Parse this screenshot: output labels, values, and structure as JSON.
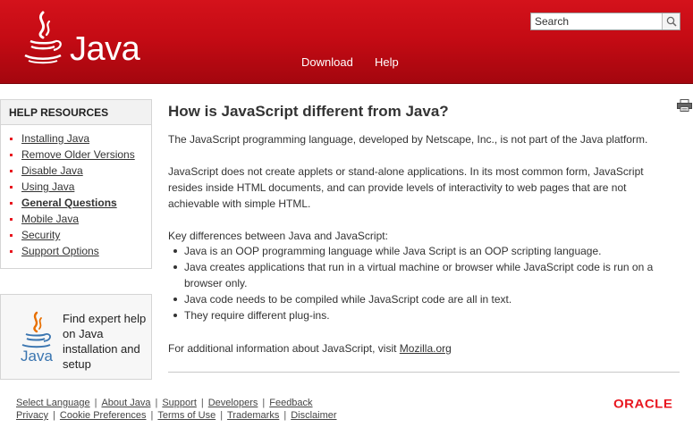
{
  "header": {
    "brand": "Java",
    "nav": [
      {
        "label": "Download"
      },
      {
        "label": "Help"
      }
    ],
    "search": {
      "placeholder": "Search"
    }
  },
  "sidebar": {
    "help_resources": {
      "title": "HELP RESOURCES",
      "items": [
        {
          "label": "Installing Java",
          "active": false
        },
        {
          "label": "Remove Older Versions",
          "active": false
        },
        {
          "label": "Disable Java",
          "active": false
        },
        {
          "label": "Using Java",
          "active": false
        },
        {
          "label": "General Questions",
          "active": true
        },
        {
          "label": "Mobile Java",
          "active": false
        },
        {
          "label": "Security",
          "active": false
        },
        {
          "label": "Support Options",
          "active": false
        }
      ]
    },
    "expert": {
      "logo_word": "Java",
      "text": "Find expert help on Java installation and setup"
    }
  },
  "main": {
    "title": "How is JavaScript different from Java?",
    "para1": "The JavaScript programming language, developed by Netscape, Inc., is not part of the Java platform.",
    "para2": "JavaScript does not create applets or stand-alone applications. In its most common form, JavaScript resides inside HTML documents, and can provide levels of interactivity to web pages that are not achievable with simple HTML.",
    "differences_intro": "Key differences between Java and JavaScript:",
    "differences": [
      "Java is an OOP programming language while Java Script is an OOP scripting language.",
      "Java creates applications that run in a virtual machine or browser while JavaScript code is run on a browser only.",
      "Java code needs to be compiled while JavaScript code are all in text.",
      "They require different plug-ins."
    ],
    "more_info_prefix": "For additional information about JavaScript, visit ",
    "more_info_link": "Mozilla.org"
  },
  "footer": {
    "row1": [
      "Select Language",
      "About Java",
      "Support",
      "Developers",
      "Feedback"
    ],
    "row2": [
      "Privacy",
      "Cookie Preferences",
      "Terms of Use",
      "Trademarks",
      "Disclaimer"
    ],
    "separator": "|",
    "oracle": "ORACLE"
  },
  "colors": {
    "header_red": "#c50b14",
    "bullet_red": "#e8161f",
    "oracle_red": "#e8161f"
  }
}
